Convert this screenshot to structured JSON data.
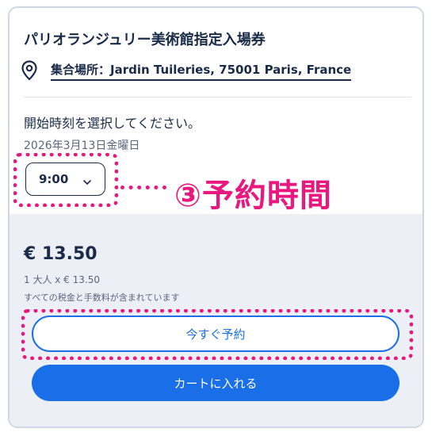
{
  "product": {
    "title": "パリオランジュリー美術館指定入場券",
    "meeting_point": "集合場所：Jardin Tuileries, 75001 Paris, France"
  },
  "booking": {
    "instruction": "開始時刻を選択してください。",
    "date": "2026年3月13日金曜日",
    "selected_time": "9:00"
  },
  "annotation": {
    "label": "③予約時間",
    "color": "#e8187e"
  },
  "pricing": {
    "total": "€ 13.50",
    "detail": "1 大人 x € 13.50",
    "tax_note": "すべての税金と手数料が含まれています"
  },
  "actions": {
    "reserve_label": "今すぐ予約",
    "cart_label": "カートに入れる"
  },
  "icons": {
    "location": "map-pin-icon",
    "dropdown": "chevron-down-icon"
  },
  "colors": {
    "primary": "#1a6fe8",
    "text": "#1a2b49",
    "panel": "#eceff5",
    "highlight": "#e8187e"
  }
}
